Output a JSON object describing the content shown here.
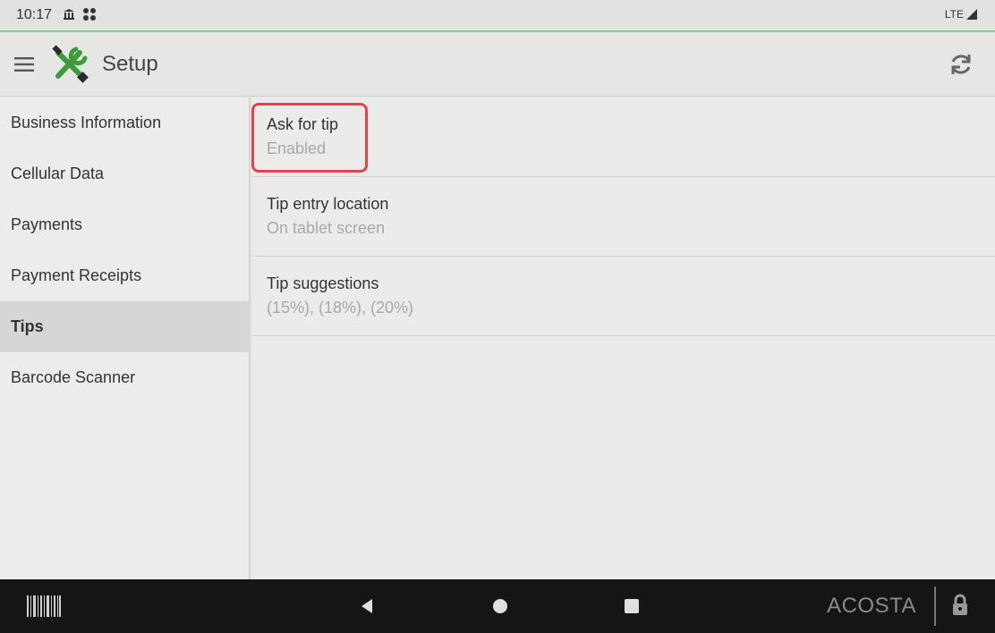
{
  "status_bar": {
    "time": "10:17",
    "icons": [
      "bank-icon",
      "apps-icon"
    ],
    "network": "LTE"
  },
  "app_bar": {
    "title": "Setup",
    "logo_icon": "tools-icon",
    "refresh_icon": "refresh-icon"
  },
  "sidebar": {
    "items": [
      {
        "label": "Business Information"
      },
      {
        "label": "Cellular Data"
      },
      {
        "label": "Payments"
      },
      {
        "label": "Payment Receipts"
      },
      {
        "label": "Tips",
        "active": true
      },
      {
        "label": "Barcode Scanner"
      }
    ]
  },
  "settings": [
    {
      "title": "Ask for tip",
      "value": "Enabled",
      "highlighted": true
    },
    {
      "title": "Tip entry location",
      "value": "On tablet screen"
    },
    {
      "title": "Tip suggestions",
      "value": "(15%), (18%), (20%)"
    }
  ],
  "nav_bar": {
    "brand": "ACOSTA"
  },
  "colors": {
    "highlight": "#e0444a",
    "accent_line": "#8fc88f",
    "logo_green": "#3d9a3d",
    "nav_bg": "#151515"
  }
}
